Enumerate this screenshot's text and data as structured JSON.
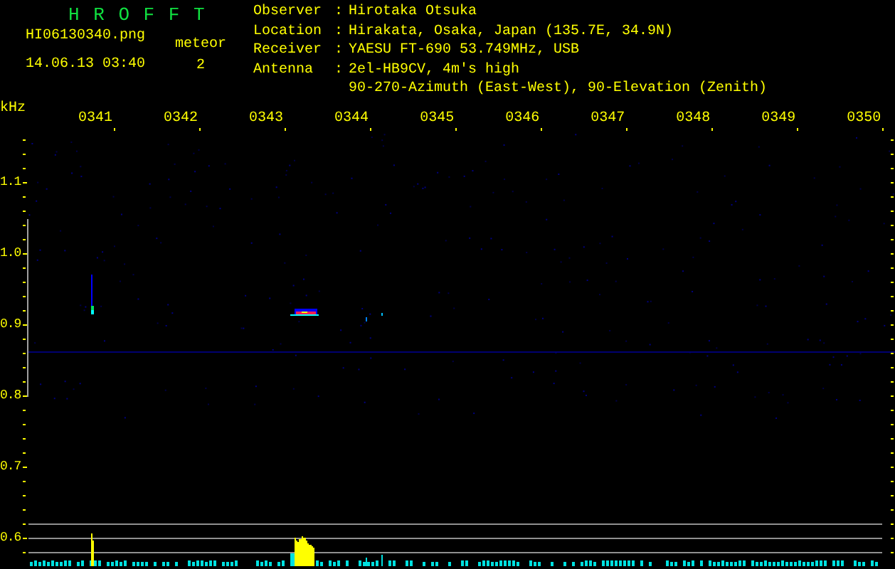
{
  "header": {
    "title": "H R O F F T",
    "filename": "HI06130340.png",
    "datetime": "14.06.13 03:40",
    "meteor_label": "meteor",
    "meteor_count": "2"
  },
  "info": [
    {
      "label": "Observer",
      "separator": ":",
      "lines": [
        "Hirotaka Otsuka"
      ]
    },
    {
      "label": "Location",
      "separator": ":",
      "lines": [
        "Hirakata, Osaka, Japan (135.7E, 34.9N)"
      ]
    },
    {
      "label": "Receiver",
      "separator": ":",
      "lines": [
        "YAESU FT-690 53.749MHz, USB"
      ]
    },
    {
      "label": "Antenna",
      "separator": ":",
      "lines": [
        "2el-HB9CV, 4m's high",
        "90-270-Azimuth (East-West), 90-Elevation (Zenith)"
      ]
    }
  ],
  "axis": {
    "unit": "kHz",
    "x_labels": [
      "0341",
      "0342",
      "0343",
      "0344",
      "0345",
      "0346",
      "0347",
      "0348",
      "0349",
      "0350"
    ],
    "y_labels": [
      "1.1",
      "1.0",
      "0.9",
      "0.8",
      "0.7",
      "0.6"
    ]
  }
}
